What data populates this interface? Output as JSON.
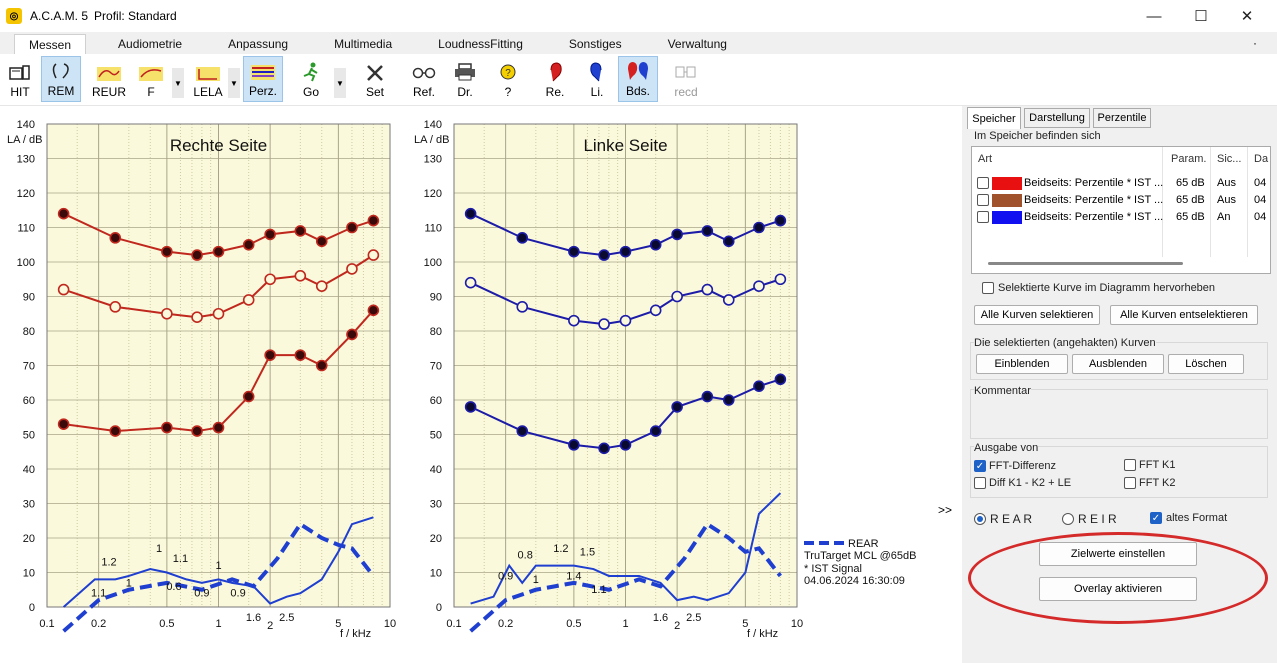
{
  "window": {
    "app": "A.C.A.M. 5",
    "profile": "Profil: Standard",
    "minimize": "—",
    "maximize": "☐",
    "close": "✕"
  },
  "menu_tabs": [
    "Messen",
    "Audiometrie",
    "Anpassung",
    "Multimedia",
    "LoudnessFitting",
    "Sonstiges",
    "Verwaltung"
  ],
  "menu_more": "·",
  "toolbar": {
    "hit": "HIT",
    "rem": "REM",
    "reur": "REUR",
    "f": "F",
    "lela": "LELA",
    "perz": "Perz.",
    "go": "Go",
    "set": "Set",
    "ref": "Ref.",
    "dr": "Dr.",
    "help": "?",
    "re": "Re.",
    "li": "Li.",
    "bds": "Bds.",
    "recd": "recd",
    "dropdown": "▼"
  },
  "chart_data": [
    {
      "type": "line",
      "title": "Rechte Seite",
      "ylabel": "LA / dB",
      "xlabel": "f / kHz",
      "ylim": [
        0,
        140
      ],
      "yticks": [
        0,
        10,
        20,
        30,
        40,
        50,
        60,
        70,
        80,
        90,
        100,
        110,
        120,
        130,
        140
      ],
      "xticks": [
        "0.1",
        "0.2",
        "0.5",
        "1",
        "1.6",
        "2",
        "2.5",
        "5",
        "10"
      ],
      "xlim": [
        0.1,
        10
      ],
      "x_scale": "log",
      "series": [
        {
          "x": [
            0.125,
            0.25,
            0.5,
            0.75,
            1,
            1.5,
            2,
            3,
            4,
            6,
            8
          ],
          "y": [
            114,
            107,
            103,
            102,
            103,
            105,
            108,
            109,
            106,
            110,
            112
          ],
          "marker": "filled",
          "color": "#c0281e"
        },
        {
          "x": [
            0.125,
            0.25,
            0.5,
            0.75,
            1,
            1.5,
            2,
            3,
            4,
            6,
            8
          ],
          "y": [
            92,
            87,
            85,
            84,
            85,
            89,
            95,
            96,
            93,
            98,
            102
          ],
          "marker": "open",
          "color": "#c0281e"
        },
        {
          "x": [
            0.125,
            0.25,
            0.5,
            0.75,
            1,
            1.5,
            2,
            3,
            4,
            6,
            8
          ],
          "y": [
            53,
            51,
            52,
            51,
            52,
            61,
            73,
            73,
            70,
            79,
            86
          ],
          "marker": "filled",
          "color": "#c0281e"
        },
        {
          "x": [
            0.125,
            0.19,
            0.25,
            0.3,
            0.4,
            0.5,
            0.65,
            0.8,
            1,
            1.2,
            1.6,
            2,
            2.5,
            3,
            4,
            5,
            6,
            8
          ],
          "y": [
            0,
            8,
            8,
            9,
            11,
            10,
            8,
            7,
            8,
            7,
            6,
            1,
            3,
            4,
            8,
            16,
            24,
            26
          ],
          "style": "solid-thin",
          "color": "#1f3fd0"
        },
        {
          "x": [
            0.125,
            0.2,
            0.3,
            0.5,
            0.8,
            1.2,
            1.6,
            2.2,
            3,
            4,
            5,
            6,
            8
          ],
          "y": [
            -7,
            2,
            5,
            7,
            5,
            8,
            6,
            14,
            24,
            20,
            18,
            17,
            9
          ],
          "style": "dashed",
          "color": "#1f3fd0"
        }
      ],
      "annotations": [
        {
          "x": 0.23,
          "y": 12,
          "text": "1.2"
        },
        {
          "x": 0.2,
          "y": 3,
          "text": "1.1"
        },
        {
          "x": 0.3,
          "y": 6,
          "text": "1"
        },
        {
          "x": 0.45,
          "y": 16,
          "text": "1"
        },
        {
          "x": 0.55,
          "y": 5,
          "text": "0.6"
        },
        {
          "x": 0.6,
          "y": 13,
          "text": "1.1"
        },
        {
          "x": 0.8,
          "y": 3,
          "text": "0.9"
        },
        {
          "x": 1.0,
          "y": 11,
          "text": "1"
        },
        {
          "x": 1.3,
          "y": 3,
          "text": "0.9"
        }
      ]
    },
    {
      "type": "line",
      "title": "Linke Seite",
      "ylabel": "LA / dB",
      "xlabel": "f / kHz",
      "ylim": [
        0,
        140
      ],
      "yticks": [
        0,
        10,
        20,
        30,
        40,
        50,
        60,
        70,
        80,
        90,
        100,
        110,
        120,
        130,
        140
      ],
      "xticks": [
        "0.1",
        "0.2",
        "0.5",
        "1",
        "1.6",
        "2",
        "2.5",
        "5",
        "10"
      ],
      "xlim": [
        0.1,
        10
      ],
      "x_scale": "log",
      "series": [
        {
          "x": [
            0.125,
            0.25,
            0.5,
            0.75,
            1,
            1.5,
            2,
            3,
            4,
            6,
            8
          ],
          "y": [
            114,
            107,
            103,
            102,
            103,
            105,
            108,
            109,
            106,
            110,
            112
          ],
          "marker": "filled",
          "color": "#1c1ca8"
        },
        {
          "x": [
            0.125,
            0.25,
            0.5,
            0.75,
            1,
            1.5,
            2,
            3,
            4,
            6,
            8
          ],
          "y": [
            94,
            87,
            83,
            82,
            83,
            86,
            90,
            92,
            89,
            93,
            95
          ],
          "marker": "open",
          "color": "#1c1ca8"
        },
        {
          "x": [
            0.125,
            0.25,
            0.5,
            0.75,
            1,
            1.5,
            2,
            3,
            4,
            6,
            8
          ],
          "y": [
            58,
            51,
            47,
            46,
            47,
            51,
            58,
            61,
            60,
            64,
            66
          ],
          "marker": "filled",
          "color": "#1c1ca8"
        },
        {
          "x": [
            0.125,
            0.17,
            0.21,
            0.25,
            0.3,
            0.4,
            0.5,
            0.65,
            0.8,
            1,
            1.2,
            1.6,
            2,
            2.5,
            3,
            4,
            5,
            6,
            8
          ],
          "y": [
            1,
            3,
            12,
            7,
            12,
            12,
            12,
            11,
            9,
            9,
            9,
            7,
            2,
            3,
            2,
            4,
            10,
            27,
            33
          ],
          "style": "solid-thin",
          "color": "#1f3fd0"
        },
        {
          "x": [
            0.125,
            0.2,
            0.3,
            0.5,
            0.8,
            1.2,
            1.6,
            2.2,
            3,
            4,
            5,
            6,
            8
          ],
          "y": [
            -7,
            2,
            5,
            7,
            5,
            8,
            6,
            14,
            24,
            20,
            16,
            17,
            9
          ],
          "style": "dashed",
          "color": "#1f3fd0"
        }
      ],
      "annotations": [
        {
          "x": 0.26,
          "y": 14,
          "text": "0.8"
        },
        {
          "x": 0.2,
          "y": 8,
          "text": "0.9"
        },
        {
          "x": 0.3,
          "y": 7,
          "text": "1"
        },
        {
          "x": 0.42,
          "y": 16,
          "text": "1.2"
        },
        {
          "x": 0.5,
          "y": 8,
          "text": "1.4"
        },
        {
          "x": 0.6,
          "y": 15,
          "text": "1.5"
        },
        {
          "x": 0.7,
          "y": 4,
          "text": "1.1"
        }
      ]
    }
  ],
  "legend": {
    "line1": "REAR",
    "line2": "TruTarget MCL @65dB",
    "line3": "* IST Signal",
    "line4": "04.06.2024 16:30:09"
  },
  "side_toggle": ">>",
  "panel": {
    "tabs": [
      "Speicher",
      "Darstellung",
      "Perzentile"
    ],
    "memory_label": "Im Speicher befinden sich",
    "columns": [
      "Art",
      "Param.",
      "Sic...",
      "Da"
    ],
    "rows": [
      {
        "name": "Beidseits: Perzentile * IST ...",
        "param": "65 dB",
        "sic": "Aus",
        "da": "04",
        "color": "#e81010"
      },
      {
        "name": "Beidseits: Perzentile * IST ...",
        "param": "65 dB",
        "sic": "Aus",
        "da": "04",
        "color": "#a0522d"
      },
      {
        "name": "Beidseits: Perzentile * IST ...",
        "param": "65 dB",
        "sic": "An",
        "da": "04",
        "color": "#1010f0"
      }
    ],
    "highlight_label": "Selektierte Kurve im Diagramm hervorheben",
    "select_all": "Alle Kurven selektieren",
    "deselect_all": "Alle Kurven entselektieren",
    "selected_group": "Die selektierten (angehakten) Kurven",
    "show": "Einblenden",
    "hide": "Ausblenden",
    "delete": "Löschen",
    "comment_label": "Kommentar",
    "output_label": "Ausgabe von",
    "fft_diff": "FFT-Differenz",
    "fft_k1": "FFT K1",
    "diff": "Diff K1 - K2 + LE",
    "fft_k2": "FFT K2",
    "rear": "R E A R",
    "reir": "R E I R",
    "old_format": "altes Format",
    "set_targets": "Zielwerte einstellen",
    "overlay": "Overlay aktivieren"
  }
}
